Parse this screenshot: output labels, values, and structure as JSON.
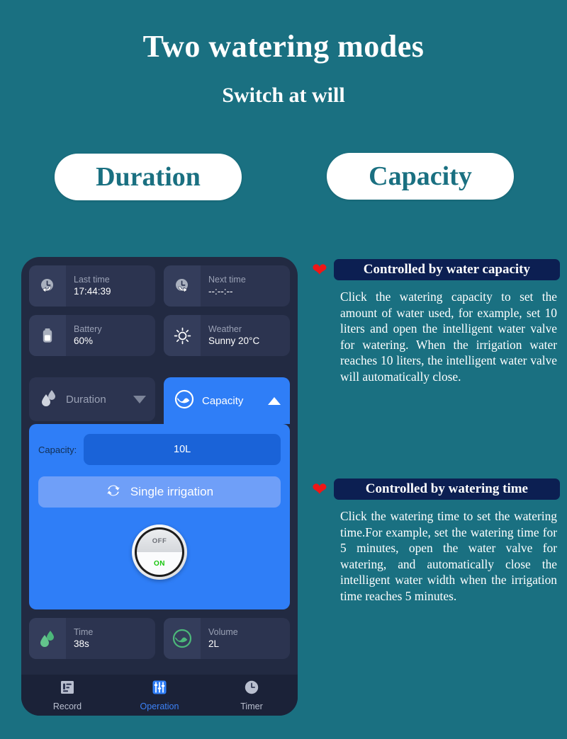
{
  "header": {
    "title": "Two watering modes",
    "subtitle": "Switch at will"
  },
  "mode_pills": [
    {
      "label": "Duration",
      "name": "pill-duration"
    },
    {
      "label": "Capacity",
      "name": "pill-capacity"
    }
  ],
  "phone": {
    "status_top": [
      {
        "label": "Last time",
        "value": "17:44:39",
        "icon": "clock-back-icon"
      },
      {
        "label": "Next time",
        "value": "--:--:--",
        "icon": "clock-forward-icon"
      }
    ],
    "status_mid": [
      {
        "label": "Battery",
        "value": "60%",
        "icon": "battery-icon"
      },
      {
        "label": "Weather",
        "value": "Sunny 20°C",
        "icon": "sun-icon"
      }
    ],
    "tabs": [
      {
        "label": "Duration",
        "icon": "water-drops-icon",
        "caret": "chevron-down-icon",
        "active": false
      },
      {
        "label": "Capacity",
        "icon": "water-level-circle-icon",
        "caret": "chevron-up-icon",
        "active": true
      }
    ],
    "panel": {
      "capacity_label": "Capacity:",
      "capacity_value": "10L",
      "single_irrigation_label": "Single irrigation",
      "single_irrigation_icon": "loop-icon",
      "knob_off_label": "OFF",
      "knob_on_label": "ON"
    },
    "status_bottom": [
      {
        "label": "Time",
        "value": "38s",
        "icon": "green-drops-icon"
      },
      {
        "label": "Volume",
        "value": "2L",
        "icon": "green-water-level-icon"
      }
    ],
    "nav": [
      {
        "label": "Record",
        "icon": "record-icon",
        "active": false
      },
      {
        "label": "Operation",
        "icon": "sliders-icon",
        "active": true
      },
      {
        "label": "Timer",
        "icon": "clock-icon",
        "active": false
      }
    ]
  },
  "info_blocks": [
    {
      "badge": "Controlled by water capacity",
      "body": "Click the watering capacity to set the amount of water used, for example, set 10 liters and open the intelligent water valve for watering. When the irrigation water reaches 10 liters, the intelligent water valve will automatically close."
    },
    {
      "badge": "Controlled by watering time",
      "body": "Click the watering time to set the watering time.For example, set the watering time for 5 minutes, open the water valve for watering, and automatically close the intelligent water width when the irrigation time reaches 5 minutes."
    }
  ],
  "colors": {
    "background_teal": "#1a7081",
    "phone_frame": "#222a42",
    "card": "#2c3450",
    "accent_blue": "#2f7ef7",
    "badge_navy": "#0c1f52",
    "heart_red": "#f01616",
    "green": "#4cb87a",
    "on_green": "#16c60c"
  }
}
